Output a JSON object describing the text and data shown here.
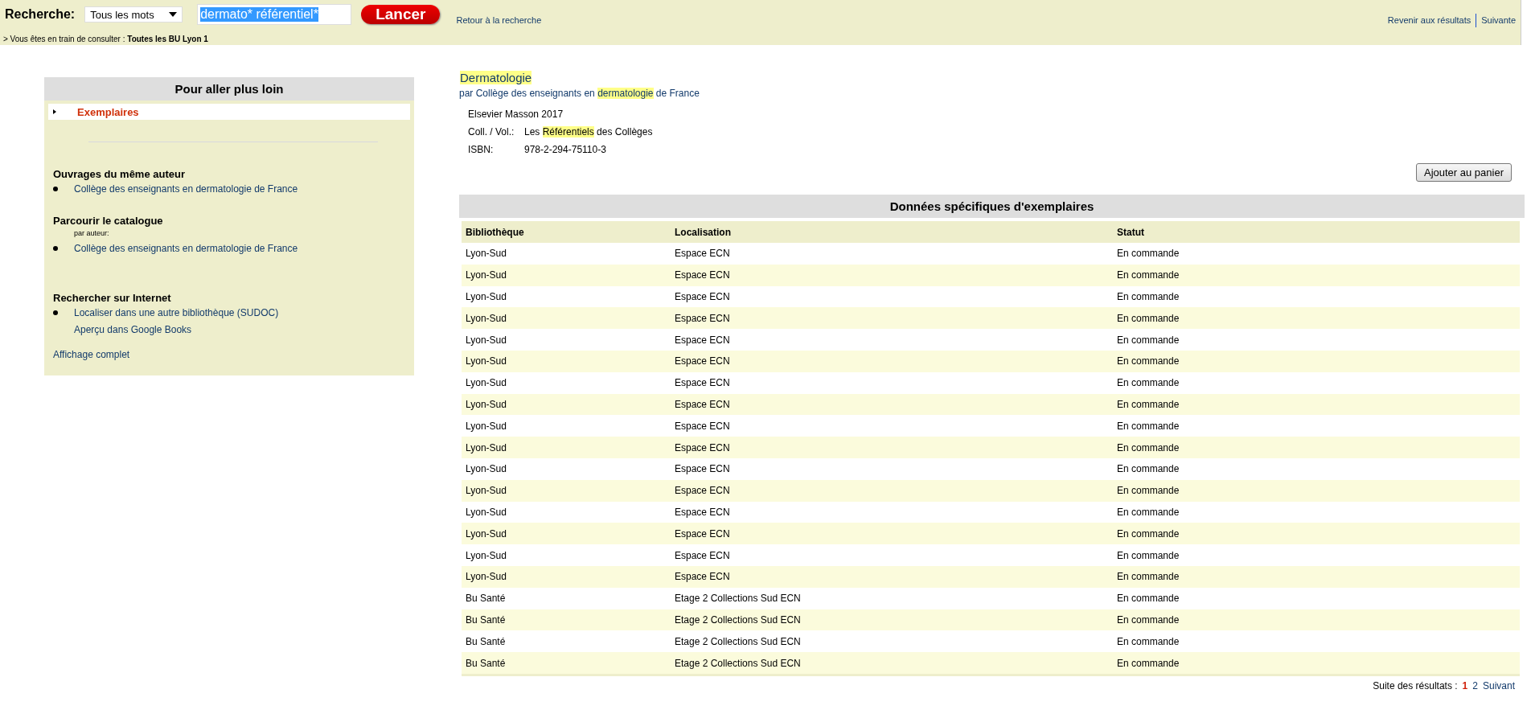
{
  "search_bar": {
    "label": "Recherche:",
    "mode": "Tous les mots",
    "query": "dermato* référentiel*",
    "query_selected": true,
    "submit": "Lancer",
    "back_link": "Retour à la recherche",
    "results_link": "Revenir aux résultats",
    "next_link": "Suivante",
    "context_prefix": "> Vous êtes en train de consulter :",
    "context_value": "Toutes les BU Lyon 1"
  },
  "sidebar": {
    "title": "Pour aller plus loin",
    "nav": [
      {
        "label": "Exemplaires",
        "selected": true
      }
    ],
    "sections": [
      {
        "heading": "Ouvrages du même auteur",
        "items": [
          {
            "kind": "bullet",
            "text": "Collège des enseignants en dermatologie de France"
          }
        ]
      },
      {
        "heading": "Parcourir le catalogue",
        "items": [
          {
            "kind": "note",
            "text": "par auteur:"
          },
          {
            "kind": "bullet",
            "text": "Collège des enseignants en dermatologie de France"
          }
        ]
      },
      {
        "heading": "Rechercher sur Internet",
        "items": [
          {
            "kind": "bullet",
            "text": "Localiser dans une autre bibliothèque (SUDOC)"
          },
          {
            "kind": "plain",
            "text": "Aperçu dans Google Books"
          }
        ]
      }
    ],
    "footer_link": "Affichage complet"
  },
  "record": {
    "title": "Dermatologie",
    "title_highlighted": true,
    "author_line": [
      {
        "text": "par Collège des enseignants en ",
        "highlighted": false
      },
      {
        "text": "dermatologie",
        "highlighted": true
      },
      {
        "text": " de France",
        "highlighted": false
      }
    ],
    "publisher": "Elsevier Masson 2017",
    "fields": [
      {
        "label": "Coll. / Vol.:",
        "value": [
          {
            "text": "Les ",
            "highlighted": false
          },
          {
            "text": "Référentiels",
            "highlighted": true
          },
          {
            "text": " des Collèges",
            "highlighted": false
          }
        ]
      },
      {
        "label": "ISBN:",
        "value": [
          {
            "text": "978-2-294-75110-3",
            "highlighted": false
          }
        ]
      }
    ],
    "cart_button": "Ajouter au panier"
  },
  "holdings": {
    "title": "Données spécifiques d'exemplaires",
    "columns": [
      "Bibliothèque",
      "Localisation",
      "Statut"
    ],
    "rows": [
      [
        "Lyon-Sud",
        "Espace ECN",
        "En commande"
      ],
      [
        "Lyon-Sud",
        "Espace ECN",
        "En commande"
      ],
      [
        "Lyon-Sud",
        "Espace ECN",
        "En commande"
      ],
      [
        "Lyon-Sud",
        "Espace ECN",
        "En commande"
      ],
      [
        "Lyon-Sud",
        "Espace ECN",
        "En commande"
      ],
      [
        "Lyon-Sud",
        "Espace ECN",
        "En commande"
      ],
      [
        "Lyon-Sud",
        "Espace ECN",
        "En commande"
      ],
      [
        "Lyon-Sud",
        "Espace ECN",
        "En commande"
      ],
      [
        "Lyon-Sud",
        "Espace ECN",
        "En commande"
      ],
      [
        "Lyon-Sud",
        "Espace ECN",
        "En commande"
      ],
      [
        "Lyon-Sud",
        "Espace ECN",
        "En commande"
      ],
      [
        "Lyon-Sud",
        "Espace ECN",
        "En commande"
      ],
      [
        "Lyon-Sud",
        "Espace ECN",
        "En commande"
      ],
      [
        "Lyon-Sud",
        "Espace ECN",
        "En commande"
      ],
      [
        "Lyon-Sud",
        "Espace ECN",
        "En commande"
      ],
      [
        "Lyon-Sud",
        "Espace ECN",
        "En commande"
      ],
      [
        "Bu Santé",
        "Etage 2 Collections Sud ECN",
        "En commande"
      ],
      [
        "Bu Santé",
        "Etage 2 Collections Sud ECN",
        "En commande"
      ],
      [
        "Bu Santé",
        "Etage 2 Collections Sud ECN",
        "En commande"
      ],
      [
        "Bu Santé",
        "Etage 2 Collections Sud ECN",
        "En commande"
      ]
    ]
  },
  "pagination": {
    "label": "Suite des résultats :",
    "pages": [
      {
        "label": "1",
        "selected": true
      },
      {
        "label": "2",
        "selected": false
      }
    ],
    "next": "Suivant"
  }
}
